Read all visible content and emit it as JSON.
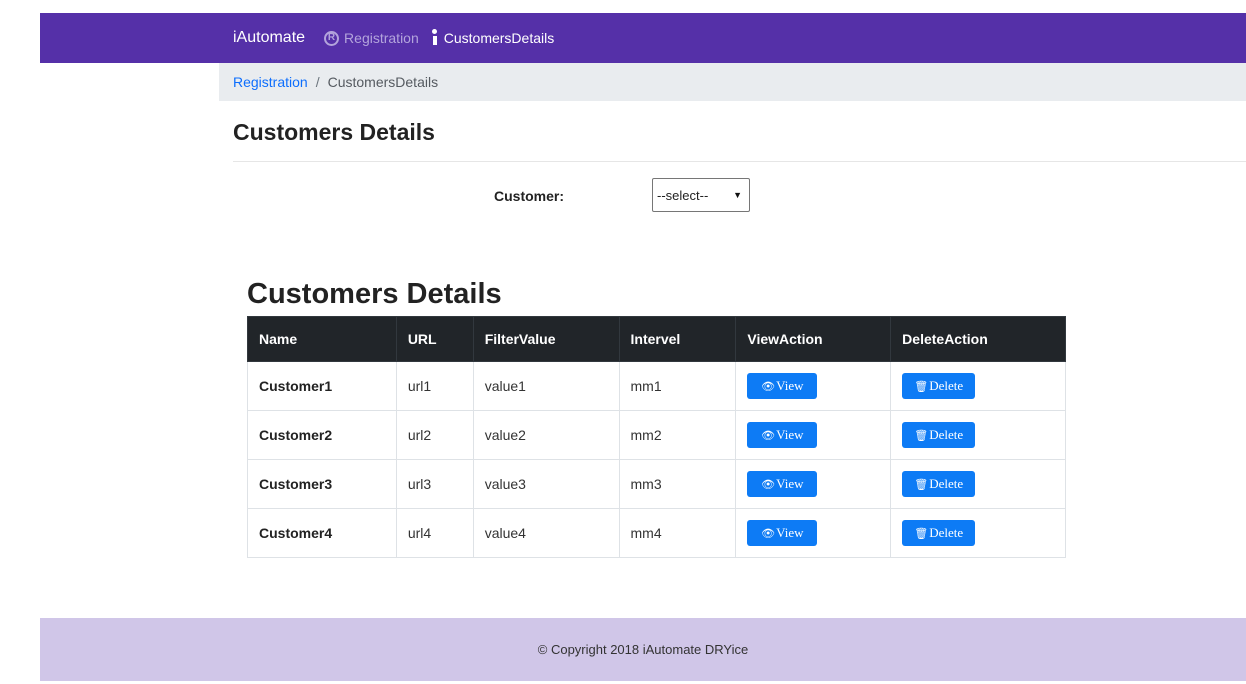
{
  "navbar": {
    "brand": "iAutomate",
    "links": [
      {
        "label": "Registration",
        "icon": "registered-icon"
      },
      {
        "label": "CustomersDetails",
        "icon": "info-icon"
      }
    ],
    "colors": {
      "background": "#5530a8",
      "muted_link": "#b3a4dc"
    }
  },
  "breadcrumb": {
    "link": "Registration",
    "separator": "/",
    "current": "CustomersDetails"
  },
  "page_title": "Customers Details",
  "filter": {
    "label": "Customer:",
    "selected": "--select--"
  },
  "table": {
    "title": "Customers Details",
    "headers": [
      "Name",
      "URL",
      "FilterValue",
      "Intervel",
      "ViewAction",
      "DeleteAction"
    ],
    "rows": [
      {
        "name": "Customer1",
        "url": "url1",
        "filter_value": "value1",
        "interval": "mm1"
      },
      {
        "name": "Customer2",
        "url": "url2",
        "filter_value": "value2",
        "interval": "mm2"
      },
      {
        "name": "Customer3",
        "url": "url3",
        "filter_value": "value3",
        "interval": "mm3"
      },
      {
        "name": "Customer4",
        "url": "url4",
        "filter_value": "value4",
        "interval": "mm4"
      }
    ],
    "view_label": "View",
    "delete_label": "Delete",
    "colors": {
      "header_bg": "#212529",
      "button": "#0d7bf5"
    }
  },
  "footer": {
    "text": "© Copyright 2018 iAutomate DRYice",
    "background": "#d0c6e8"
  }
}
